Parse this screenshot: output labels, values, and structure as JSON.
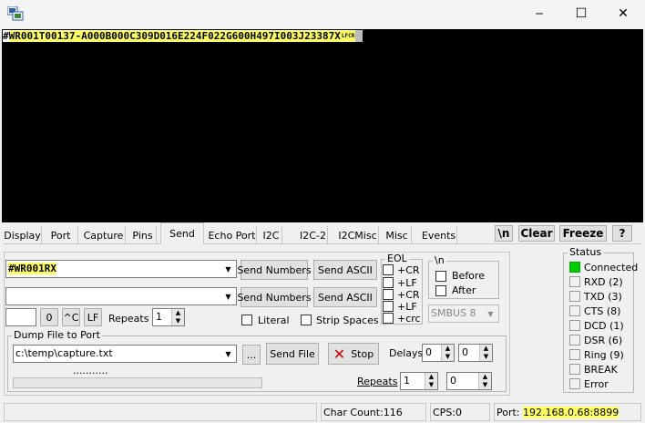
{
  "window": {
    "icon": "app-icon",
    "minimize": "─",
    "maximize": "☐",
    "close": "✕"
  },
  "terminal": {
    "prefix": "#",
    "line": "WR001T00137-A000B000C309D016E224F022G600H497I003J23387X",
    "suffix": "LFCR"
  },
  "tabs": [
    "Display",
    "Port",
    "Capture",
    "Pins",
    "Send",
    "Echo Port",
    "I2C",
    "I2C-2",
    "I2CMisc",
    "Misc",
    "Events"
  ],
  "toolbar": {
    "newline": "\\n",
    "clear": "Clear",
    "freeze": "Freeze",
    "help": "?"
  },
  "send": {
    "combo1_value": "#WR001RX",
    "combo2_value": "",
    "send_numbers_1": "Send Numbers",
    "send_ascii_1": "Send ASCII",
    "send_numbers_2": "Send Numbers",
    "send_ascii_2": "Send ASCII",
    "char_field": "",
    "char_zero": "0",
    "char_ctrl": "^C",
    "char_lf": "LF",
    "repeats_label": "Repeats",
    "repeats_value": "1",
    "literal": "Literal",
    "strip_spaces": "Strip Spaces"
  },
  "eol": {
    "title": "EOL",
    "items": [
      "+CR",
      "+LF",
      "+CR",
      "+LF",
      "+crc"
    ]
  },
  "nl": {
    "title": "\\n",
    "before": "Before",
    "after": "After",
    "smbus": "SMBUS 8"
  },
  "dump": {
    "title": "Dump File to Port",
    "path": "c:\\temp\\capture.txt",
    "browse": "...",
    "send_file": "Send File",
    "stop": "Stop",
    "dots": "...........",
    "delays_label": "Delays",
    "delay1": "0",
    "delay2": "0",
    "repeats_label": "Repeats",
    "repeats1": "1",
    "repeats2": "0"
  },
  "status": {
    "title": "Status",
    "items": [
      "Connected",
      "RXD (2)",
      "TXD (3)",
      "CTS (8)",
      "DCD (1)",
      "DSR (6)",
      "Ring (9)",
      "BREAK",
      "Error"
    ]
  },
  "statusbar": {
    "char_count": "Char Count:116",
    "cps": "CPS:0",
    "port_label": "Port:",
    "port_value": "192.168.0.68:8899"
  },
  "colors": {
    "terminal_bg": "#000000",
    "terminal_text": "#ffff66",
    "connected_led": "#00cc00",
    "stop_icon": "#cc0000"
  }
}
